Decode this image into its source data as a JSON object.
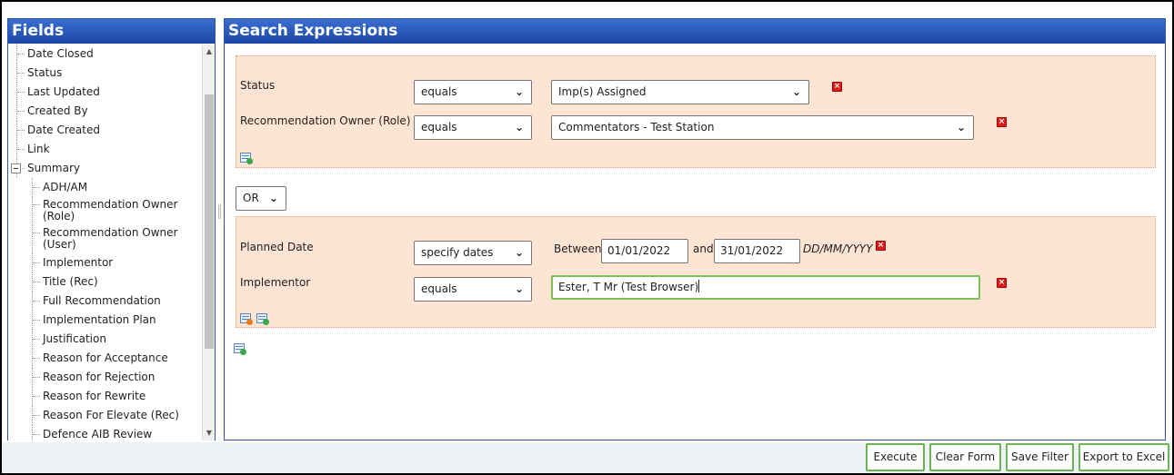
{
  "fields_panel": {
    "title": "Fields",
    "items": [
      {
        "label": "Date Closed"
      },
      {
        "label": "Status"
      },
      {
        "label": "Last Updated"
      },
      {
        "label": "Created By"
      },
      {
        "label": "Date Created"
      },
      {
        "label": "Link"
      },
      {
        "label": "Summary"
      },
      {
        "label": "ADH/AM"
      },
      {
        "label": "Recommendation Owner (Role)"
      },
      {
        "label": "Recommendation Owner (User)"
      },
      {
        "label": "Implementor"
      },
      {
        "label": "Title (Rec)"
      },
      {
        "label": "Full Recommendation"
      },
      {
        "label": "Implementation Plan"
      },
      {
        "label": "Justification"
      },
      {
        "label": "Reason for Acceptance"
      },
      {
        "label": "Reason for Rejection"
      },
      {
        "label": "Reason for Rewrite"
      },
      {
        "label": "Reason For Elevate (Rec)"
      },
      {
        "label": "Defence AIB Review"
      }
    ]
  },
  "search_panel": {
    "title": "Search Expressions",
    "group1": {
      "conditions": [
        {
          "field": "Status",
          "operator": "equals",
          "value": "Imp(s) Assigned"
        },
        {
          "field": "Recommendation Owner (Role)",
          "operator": "equals",
          "value": "Commentators - Test Station"
        }
      ]
    },
    "connector": "OR",
    "group2": {
      "conditions": [
        {
          "field": "Planned Date",
          "operator": "specify dates",
          "between_label": "Between",
          "from_date": "01/01/2022",
          "and_label": "and",
          "to_date": "31/01/2022",
          "format_hint": "DD/MM/YYYY"
        },
        {
          "field": "Implementor",
          "operator": "equals",
          "value": "Ester, T Mr (Test Browser)"
        }
      ]
    }
  },
  "toolbar": {
    "execute": "Execute",
    "clear_form": "Clear Form",
    "save_filter": "Save Filter",
    "export_excel": "Export to Excel"
  },
  "colors": {
    "header_blue": "#1c47a6",
    "group_fill": "#fde4d3",
    "button_border": "#6cb356",
    "delete_red": "#d91c1c"
  }
}
